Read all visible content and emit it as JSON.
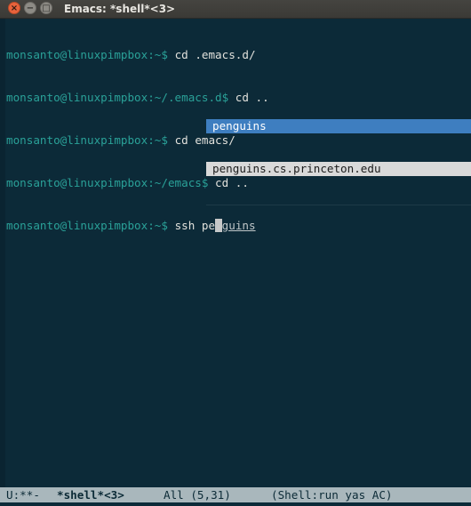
{
  "window": {
    "title": "Emacs: *shell*<3>",
    "close_glyph": "×",
    "minimize_glyph": "−",
    "maximize_glyph": "□"
  },
  "shell": {
    "lines": [
      {
        "prompt": "monsanto@linuxpimpbox:~$",
        "command": " cd .emacs.d/"
      },
      {
        "prompt": "monsanto@linuxpimpbox:~/.emacs.d$",
        "command": " cd .."
      },
      {
        "prompt": "monsanto@linuxpimpbox:~$",
        "command": " cd emacs/"
      },
      {
        "prompt": "monsanto@linuxpimpbox:~/emacs$",
        "command": " cd .."
      }
    ],
    "current": {
      "prompt": "monsanto@linuxpimpbox:~$",
      "typed": " ssh pe",
      "cursor_char": "n",
      "completion_rest": "guins"
    }
  },
  "completion_popup": {
    "items": [
      {
        "label": "penguins",
        "selected": true
      },
      {
        "label": "penguins.cs.princeton.edu",
        "selected": false
      }
    ]
  },
  "modeline": {
    "status": "U:**-",
    "buffer_name": "*shell*<3>",
    "position": "All (5,31)",
    "modes": "(Shell:run yas AC)"
  },
  "colors": {
    "background": "#0c2a38",
    "prompt": "#2aa198",
    "text": "#e1e1dc",
    "popup_selected": "#3e7ec0",
    "popup_item": "#d9d9d9",
    "modeline": "#a9b7bc"
  }
}
